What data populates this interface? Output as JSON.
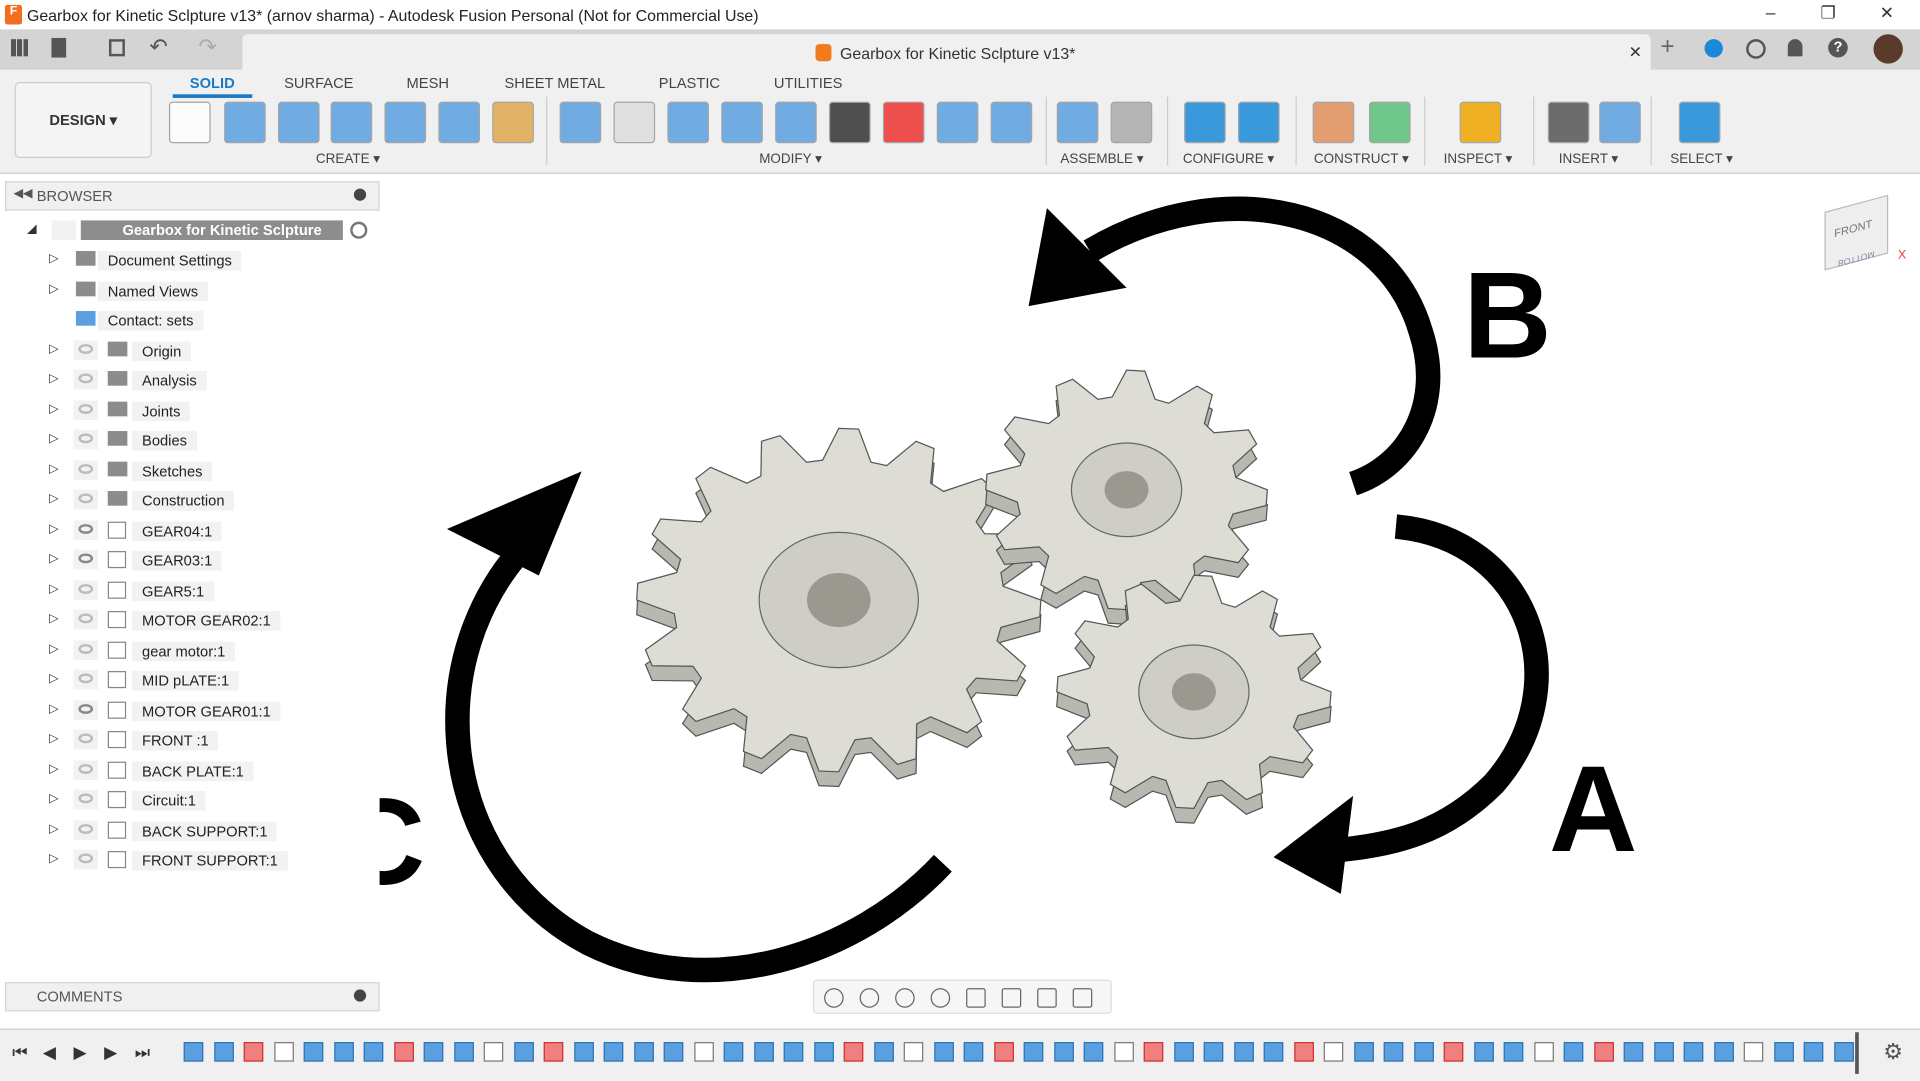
{
  "window": {
    "title": "Gearbox for Kinetic Sclpture v13* (arnov sharma) - Autodesk Fusion Personal (Not for Commercial Use)",
    "minimize": "–",
    "maximize": "❐",
    "close": "✕"
  },
  "document_tab": {
    "title": "Gearbox for Kinetic Sclpture v13*",
    "close": "✕"
  },
  "workspace": {
    "label": "DESIGN ▾"
  },
  "ribbon": {
    "tabs": [
      "SOLID",
      "SURFACE",
      "MESH",
      "SHEET METAL",
      "PLASTIC",
      "UTILITIES"
    ],
    "active_tab": "SOLID",
    "groups": [
      "CREATE ▾",
      "MODIFY ▾",
      "ASSEMBLE ▾",
      "CONFIGURE ▾",
      "CONSTRUCT ▾",
      "INSPECT ▾",
      "INSERT ▾",
      "SELECT ▾"
    ]
  },
  "browser": {
    "title": "BROWSER",
    "root": "Gearbox for Kinetic Sclpture v...",
    "items": [
      {
        "label": "Document Settings",
        "icon": "gear-icon",
        "visible": null
      },
      {
        "label": "Named Views",
        "icon": "folder-icon",
        "visible": null
      },
      {
        "label": "Contact: sets",
        "icon": "contact-sets-icon",
        "visible": null
      },
      {
        "label": "Origin",
        "icon": "folder-icon",
        "visible": false
      },
      {
        "label": "Analysis",
        "icon": "folder-icon",
        "visible": false
      },
      {
        "label": "Joints",
        "icon": "folder-icon",
        "visible": false
      },
      {
        "label": "Bodies",
        "icon": "folder-icon",
        "visible": false
      },
      {
        "label": "Sketches",
        "icon": "folder-icon",
        "visible": false
      },
      {
        "label": "Construction",
        "icon": "folder-icon",
        "visible": false
      },
      {
        "label": "GEAR04:1",
        "icon": "component-icon",
        "visible": true
      },
      {
        "label": "GEAR03:1",
        "icon": "component-icon",
        "visible": true
      },
      {
        "label": "GEAR5:1",
        "icon": "component-icon",
        "visible": false
      },
      {
        "label": "MOTOR GEAR02:1",
        "icon": "component-icon",
        "visible": false
      },
      {
        "label": "gear motor:1",
        "icon": "component-icon",
        "visible": false
      },
      {
        "label": "MID pLATE:1",
        "icon": "component-icon",
        "visible": false
      },
      {
        "label": "MOTOR GEAR01:1",
        "icon": "component-icon",
        "visible": true
      },
      {
        "label": "FRONT :1",
        "icon": "component-icon",
        "visible": false
      },
      {
        "label": "BACK PLATE:1",
        "icon": "component-icon",
        "visible": false
      },
      {
        "label": "Circuit:1",
        "icon": "component-icon",
        "visible": false
      },
      {
        "label": "BACK SUPPORT:1",
        "icon": "component-icon",
        "visible": false
      },
      {
        "label": "FRONT SUPPORT:1",
        "icon": "component-icon",
        "visible": false
      }
    ]
  },
  "comments": {
    "title": "COMMENTS"
  },
  "viewcube": {
    "face": "FRONT",
    "bottom": "BOTTOM",
    "axis": "X"
  },
  "viewport": {
    "labels": {
      "a": "A",
      "b": "B",
      "c": "C"
    }
  },
  "colors": {
    "accent": "#1a7ac8",
    "gear": "#deddd5",
    "gear_edge": "#555",
    "arrow": "#000000"
  },
  "timeline": {
    "controls": [
      "⏮",
      "◀",
      "▶",
      "▶",
      "⏭"
    ],
    "settings": "⚙"
  }
}
